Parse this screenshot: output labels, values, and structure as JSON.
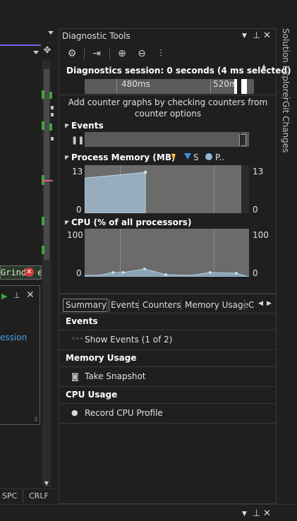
{
  "panel": {
    "title": "Diagnostic Tools",
    "session": "Diagnostics session: 0 seconds (4 ms selected)",
    "timeline_ticks": [
      "480ms",
      "520m"
    ],
    "hint": "Add counter graphs by checking counters from counter options"
  },
  "toolbar": {
    "settings_icon": "gear-icon",
    "select_tools_icon": "export-icon",
    "zoom_in_icon": "zoom-in-icon",
    "zoom_out_icon": "zoom-out-icon",
    "reset_icon": "reset-zoom-icon"
  },
  "events": {
    "label": "Events"
  },
  "memory": {
    "label": "Process Memory (MB)",
    "legend": [
      "",
      "S",
      "P.."
    ],
    "y_max_left": "13",
    "y_min_left": "0",
    "y_max_right": "13",
    "y_min_right": "0",
    "level_fraction": 0.85
  },
  "cpu": {
    "label": "CPU (% of all processors)",
    "y_max_left": "100",
    "y_min_left": "0",
    "y_max_right": "100",
    "y_min_right": "0"
  },
  "tabs": [
    "Summary",
    "Events",
    "Counters",
    "Memory Usage",
    "C"
  ],
  "summary": {
    "events_head": "Events",
    "show_events": "Show Events (1 of 2)",
    "memory_head": "Memory Usage",
    "take_snapshot": "Take Snapshot",
    "cpu_head": "CPU Usage",
    "record_cpu": "Record CPU Profile"
  },
  "side_tabs": [
    "Solution Explorer",
    "Git Changes"
  ],
  "editor": {
    "find_text": "Grind",
    "find_suffix": "e",
    "link_text": "ession",
    "status_items": [
      "SPC",
      "CRLF"
    ]
  }
}
